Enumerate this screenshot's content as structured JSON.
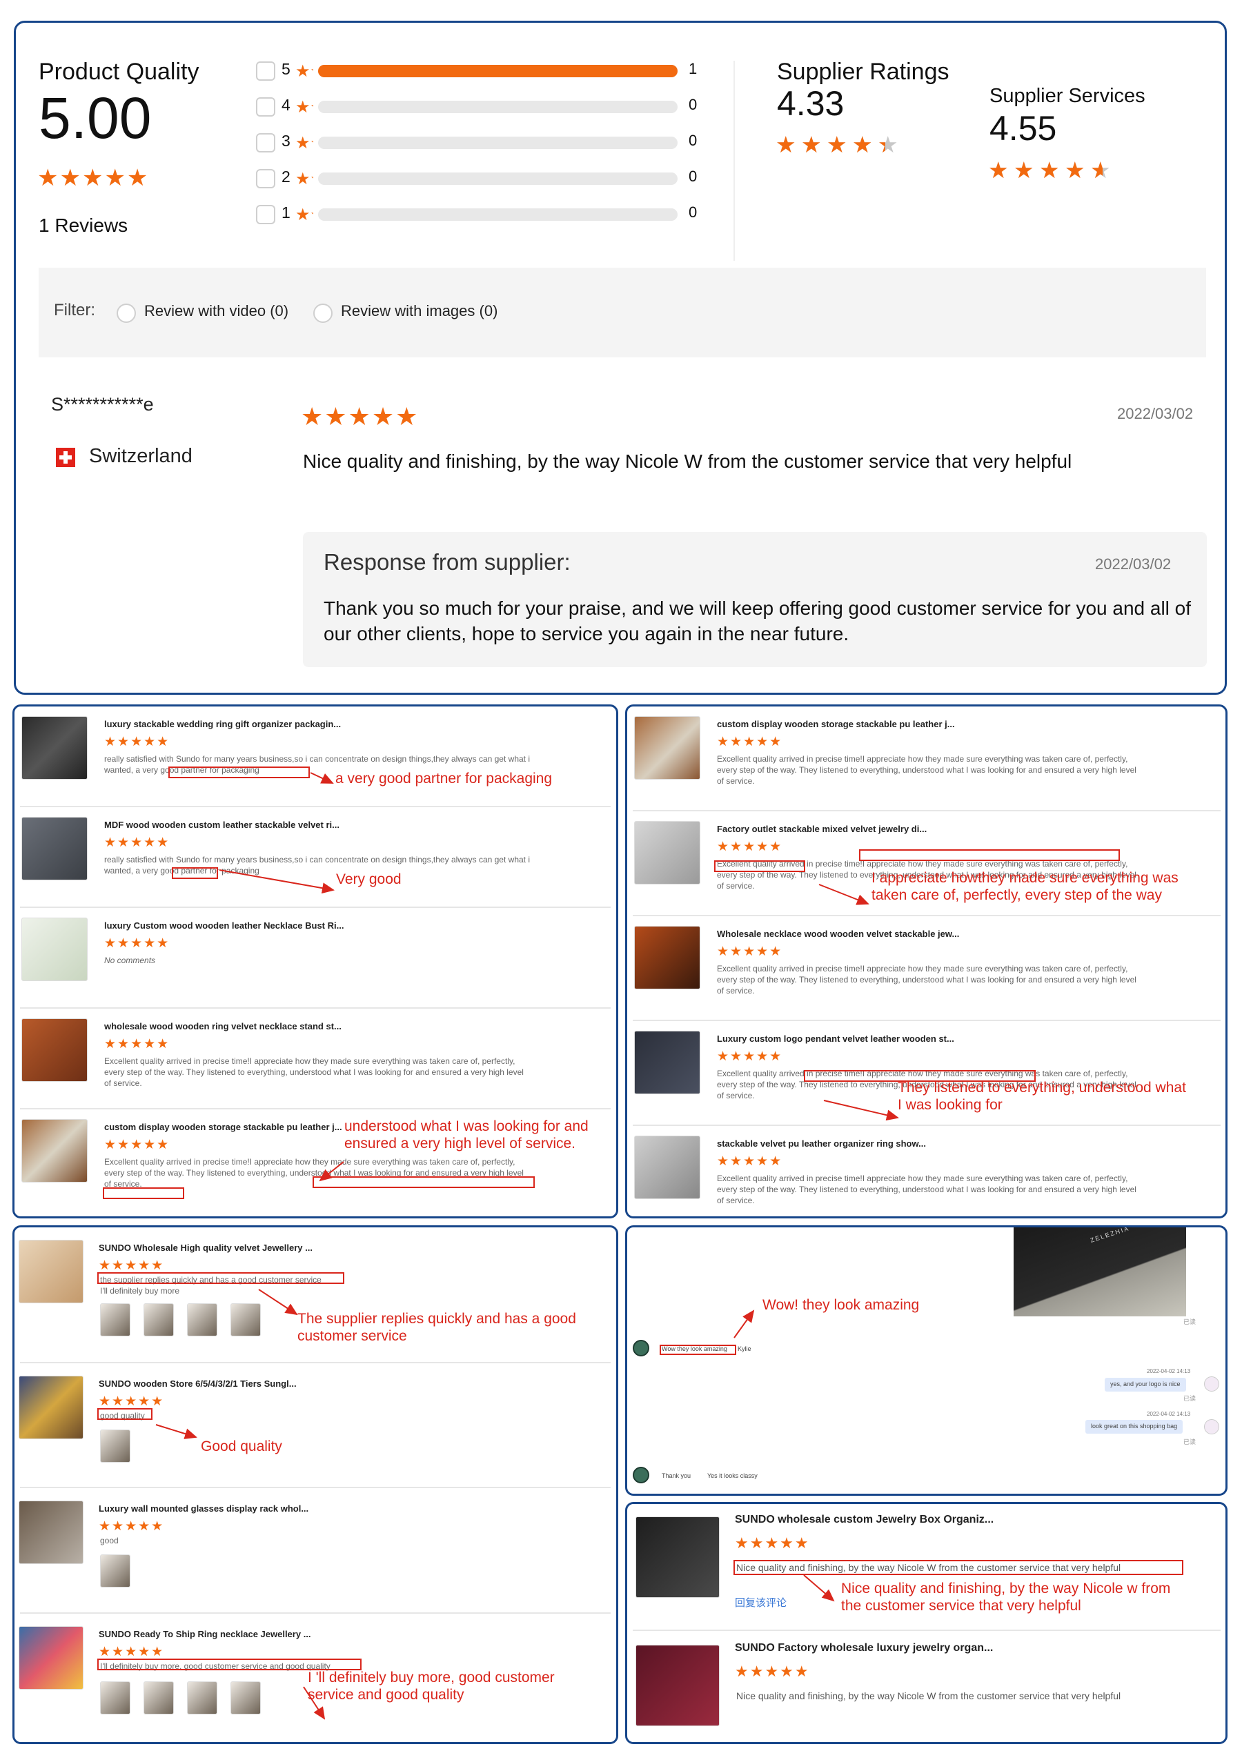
{
  "summary": {
    "product_quality_label": "Product Quality",
    "product_quality_score": "5.00",
    "reviews_count": "1 Reviews",
    "stars": "★★★★★",
    "breakdown": [
      {
        "level": "5",
        "count": "1",
        "fraction": 1.0
      },
      {
        "level": "4",
        "count": "0",
        "fraction": 0
      },
      {
        "level": "3",
        "count": "0",
        "fraction": 0
      },
      {
        "level": "2",
        "count": "0",
        "fraction": 0
      },
      {
        "level": "1",
        "count": "0",
        "fraction": 0
      }
    ],
    "supplier_ratings_label": "Supplier Ratings",
    "supplier_ratings_score": "4.33",
    "supplier_ratings_value": 4.33,
    "supplier_services_label": "Supplier Services",
    "supplier_services_score": "4.55",
    "supplier_services_value": 4.55
  },
  "filter": {
    "label": "Filter:",
    "video": "Review with video (0)",
    "images": "Review with images (0)"
  },
  "review": {
    "user": "S***********e",
    "country": "Switzerland",
    "date": "2022/03/02",
    "text": "Nice quality and finishing, by the way Nicole W from the customer service that very helpful",
    "response_title": "Response from supplier:",
    "response_date": "2022/03/02",
    "response_text": "Thank you so much for your praise, and we will keep offering good customer service for you and all of our other clients, hope to service you again in the near future."
  },
  "colors": {
    "accent": "#f26a10",
    "frame": "#17468a",
    "annotation": "#d9261c"
  },
  "panel_a": [
    {
      "title": "luxury stackable wedding ring gift organizer packagin...",
      "text": "really satisfied with Sundo for many years business,so i can concentrate on design things,they always can get what i wanted, a very good partner for packaging",
      "annotation": "a very good partner for packaging"
    },
    {
      "title": "MDF wood wooden custom leather stackable velvet ri...",
      "text": "really satisfied with Sundo for many years business,so i can concentrate on design things,they always can get what i wanted, a very good partner for packaging",
      "annotation": "Very good"
    },
    {
      "title": "luxury Custom wood wooden leather Necklace Bust Ri...",
      "text": "No comments",
      "annotation": ""
    },
    {
      "title": "wholesale wood wooden ring velvet necklace stand st...",
      "text": "Excellent quality arrived in precise time!I appreciate how they made sure everything was taken care of, perfectly, every step of the way. They listened to everything, understood what I was looking for and ensured a very high level of service.",
      "annotation": ""
    },
    {
      "title": "custom display wooden storage stackable pu leather j...",
      "text": "Excellent quality arrived in precise time!I appreciate how they made sure everything was taken care of, perfectly, every step of the way. They listened to everything, understood what I was looking for and ensured a very high level of service.",
      "annotation": "understood what I was looking for and ensured a very high level of service."
    }
  ],
  "panel_b": [
    {
      "title": "custom display wooden storage stackable pu leather j...",
      "text": "Excellent quality arrived in precise time!I appreciate how they made sure everything was taken care of, perfectly, every step of the way. They listened to everything, understood what I was looking for and ensured a very high level of service.",
      "annotation": ""
    },
    {
      "title": "Factory outlet stackable mixed velvet jewelry di...",
      "text": "Excellent quality arrived in precise time!I appreciate how they made sure everything was taken care of, perfectly, every step of the way. They listened to everything, understood what I was looking for and ensured a very high level of service.",
      "annotation": "I appreciate howthey made sure everything was taken care of, perfectly, every step of the way"
    },
    {
      "title": "Wholesale necklace wood wooden velvet stackable jew...",
      "text": "Excellent quality arrived in precise time!I appreciate how they made sure everything was taken care of, perfectly, every step of the way. They listened to everything, understood what I was looking for and ensured a very high level of service.",
      "annotation": ""
    },
    {
      "title": "Luxury custom logo pendant velvet leather wooden st...",
      "text": "Excellent quality arrived in precise time!I appreciate how they made sure everything was taken care of, perfectly, every step of the way. They listened to everything, understood what I was looking for and ensured a very high level of service.",
      "annotation": "They listened to everything, understood what I was looking for"
    },
    {
      "title": "stackable velvet pu leather organizer ring show...",
      "text": "Excellent quality arrived in precise time!I appreciate how they made sure everything was taken care of, perfectly, every step of the way. They listened to everything, understood what I was looking for and ensured a very high level of service.",
      "annotation": ""
    }
  ],
  "panel_c": [
    {
      "title": "SUNDO Wholesale High quality velvet Jewellery ...",
      "text": "the supplier replies quickly and has a good customer service",
      "text2": "I'll definitely buy more",
      "annotation": "The supplier replies quickly and has a good customer service"
    },
    {
      "title": "SUNDO wooden Store 6/5/4/3/2/1 Tiers Sungl...",
      "text": "good quality",
      "text2": "",
      "annotation": "Good quality"
    },
    {
      "title": "Luxury wall mounted glasses display rack whol...",
      "text": "good",
      "text2": "",
      "annotation": ""
    },
    {
      "title": "SUNDO Ready To Ship Ring necklace Jewellery ...",
      "text": "I'll definitely buy more, good customer service and good quality",
      "text2": "",
      "annotation": "I 'll definitely buy more, good customer service and good quality"
    }
  ],
  "chat": {
    "brand": "ZELEZHIA",
    "read1": "已读",
    "msg1": "Wow they look amazing",
    "msg1_tail": "Kylie",
    "annotation": "Wow! they look amazing",
    "time1": "2022-04-02 14:13",
    "reply1": "yes, and your logo is nice",
    "read2": "已读",
    "time2": "2022-04-02 14:13",
    "reply2": "look great on this shopping bag",
    "read3": "已读",
    "msg2": "Thank you",
    "msg2_tail": "Yes it looks classy"
  },
  "panel_e": [
    {
      "title": "SUNDO wholesale custom Jewelry Box Organiz...",
      "text": "Nice quality and finishing, by the way Nicole W from the customer service that very helpful",
      "link": "回复该评论",
      "annotation": "Nice quality and finishing, by the way Nicole w from the customer service that very helpful"
    },
    {
      "title": "SUNDO Factory wholesale luxury jewelry organ...",
      "text": "Nice quality and finishing, by the way Nicole W from the customer service that very helpful",
      "link": "",
      "annotation": ""
    }
  ]
}
